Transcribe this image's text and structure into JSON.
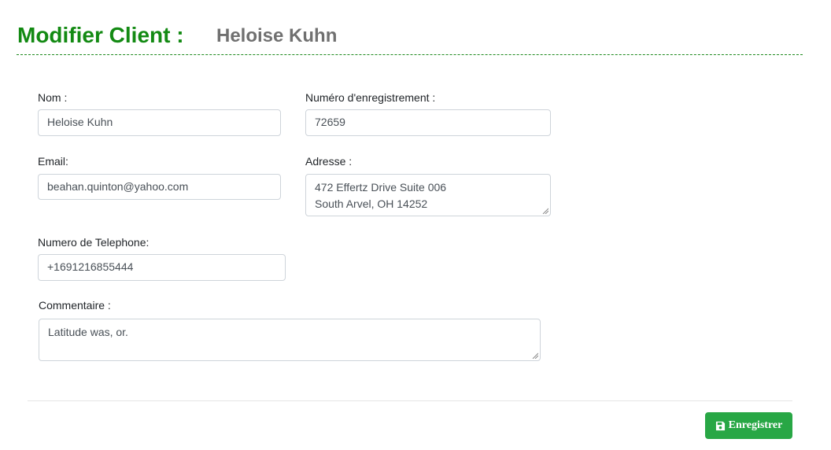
{
  "header": {
    "title": "Modifier Client :",
    "client_name": "Heloise Kuhn"
  },
  "form": {
    "nom": {
      "label": "Nom :",
      "value": "Heloise Kuhn"
    },
    "numero_enregistrement": {
      "label": "Numéro d'enregistrement :",
      "value": "72659"
    },
    "email": {
      "label": "Email:",
      "value": "beahan.quinton@yahoo.com"
    },
    "adresse": {
      "label": "Adresse :",
      "lines": [
        "472 Effertz Drive Suite 006",
        "South Arvel, OH 14252"
      ]
    },
    "telephone": {
      "label": "Numero de Telephone:",
      "value": "+1691216855444"
    },
    "commentaire": {
      "label": "Commentaire :",
      "value": "Latitude was, or."
    }
  },
  "footer": {
    "save_label": "Enregistrer",
    "save_icon": "floppy-disk-icon"
  },
  "colors": {
    "title": "#138a13",
    "client_name": "#707070",
    "header_rule": "#1f8a1f",
    "save_button": "#28a745"
  }
}
